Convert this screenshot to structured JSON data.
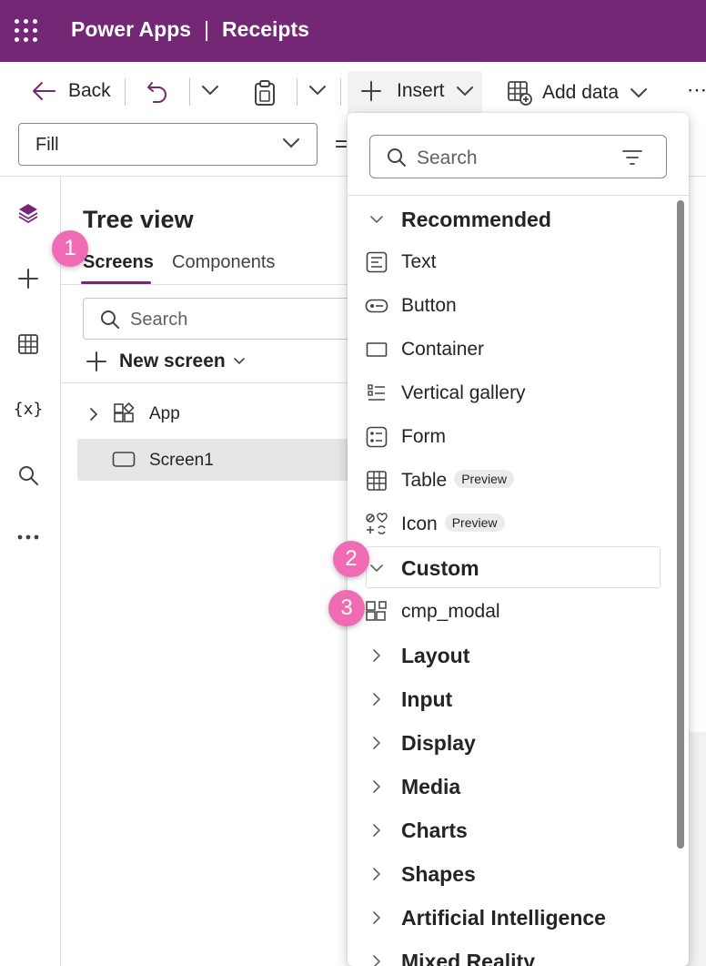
{
  "header": {
    "product": "Power Apps",
    "separator": "|",
    "app_name": "Receipts",
    "background": "#742774"
  },
  "toolbar": {
    "back_label": "Back",
    "insert_label": "Insert",
    "add_data_label": "Add data",
    "property_value": "Fill",
    "formula_symbol": "="
  },
  "rail": {
    "variables_label": "{x}"
  },
  "tree_view": {
    "title": "Tree view",
    "tabs": [
      {
        "label": "Screens",
        "active": true
      },
      {
        "label": "Components",
        "active": false
      }
    ],
    "search_placeholder": "Search",
    "new_screen_label": "New screen",
    "items": [
      {
        "label": "App",
        "icon": "app-icon",
        "expandable": true
      },
      {
        "label": "Screen1",
        "icon": "screen-icon",
        "selected": true
      }
    ]
  },
  "insert_panel": {
    "search_placeholder": "Search",
    "recommended": {
      "label": "Recommended",
      "expanded": true,
      "items": [
        {
          "label": "Text",
          "icon": "text-icon"
        },
        {
          "label": "Button",
          "icon": "button-icon"
        },
        {
          "label": "Container",
          "icon": "container-icon"
        },
        {
          "label": "Vertical gallery",
          "icon": "gallery-icon"
        },
        {
          "label": "Form",
          "icon": "form-icon"
        },
        {
          "label": "Table",
          "icon": "table-icon",
          "badge": "Preview"
        },
        {
          "label": "Icon",
          "icon": "icons-icon",
          "badge": "Preview"
        }
      ]
    },
    "custom": {
      "label": "Custom",
      "expanded": true,
      "items": [
        {
          "label": "cmp_modal",
          "icon": "component-icon"
        }
      ]
    },
    "categories": [
      "Layout",
      "Input",
      "Display",
      "Media",
      "Charts",
      "Shapes",
      "Artificial Intelligence",
      "Mixed Reality"
    ]
  },
  "callouts": [
    "1",
    "2",
    "3"
  ],
  "colors": {
    "accent": "#742774",
    "callout": "#ef6cb4"
  }
}
